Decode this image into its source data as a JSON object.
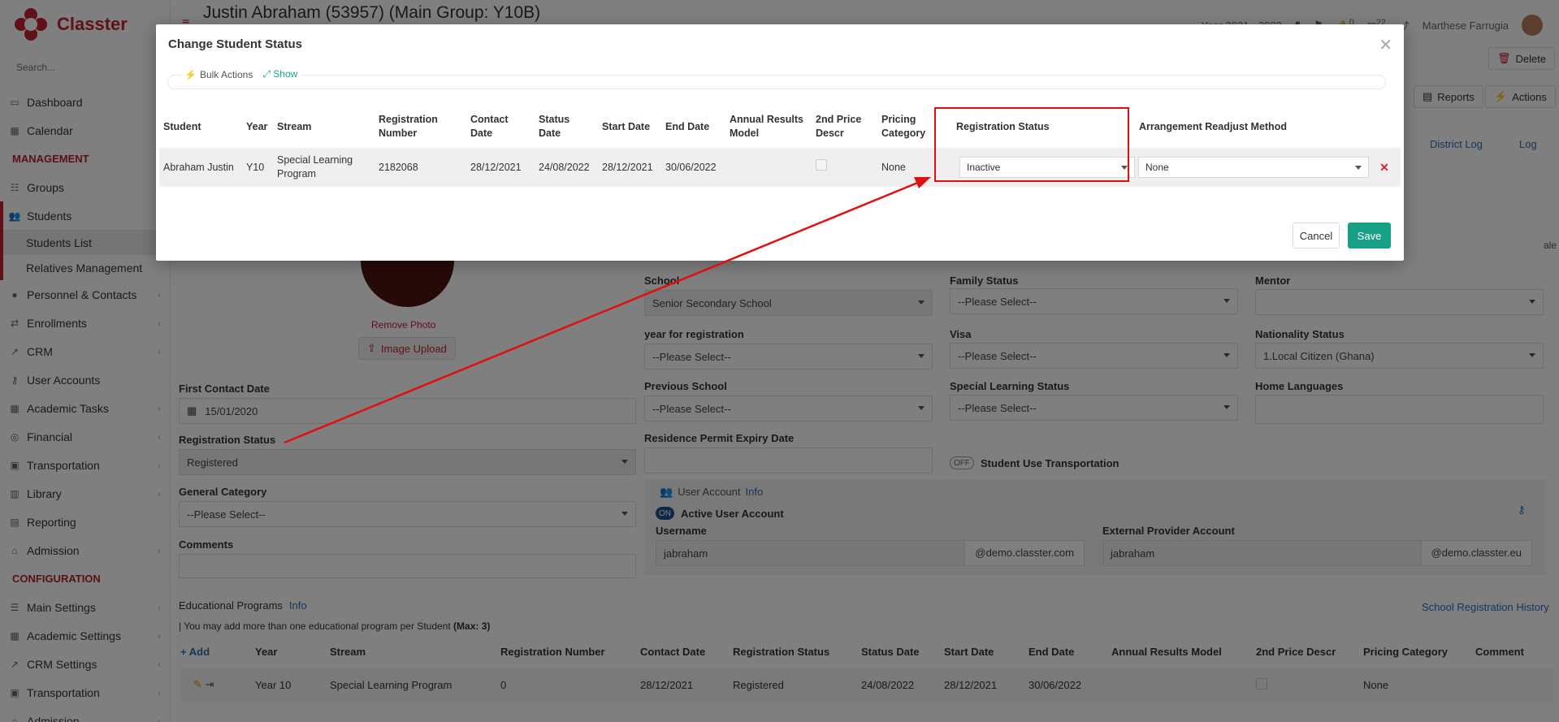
{
  "app": {
    "brand": "Classter",
    "search_placeholder": "Search...",
    "page_title": "Justin Abraham (53957) (Main Group: Y10B)",
    "year_selector": "Year 2021 - 2022",
    "user_name": "Marthese Farrugia",
    "notif_count_1": "0",
    "notif_count_2": "22"
  },
  "sidebar": {
    "items": [
      {
        "label": "Dashboard",
        "icon": "monitor-icon"
      },
      {
        "label": "Calendar",
        "icon": "calendar-icon"
      }
    ],
    "section_management": "MANAGEMENT",
    "management": [
      {
        "label": "Groups",
        "icon": "groups-icon"
      },
      {
        "label": "Students",
        "icon": "students-icon"
      }
    ],
    "students_sub": [
      "Students List",
      "Relatives Management"
    ],
    "management2": [
      {
        "label": "Personnel & Contacts",
        "icon": "person-icon"
      },
      {
        "label": "Enrollments",
        "icon": "exchange-icon"
      },
      {
        "label": "CRM",
        "icon": "crm-icon"
      },
      {
        "label": "User Accounts",
        "icon": "key-icon"
      },
      {
        "label": "Academic Tasks",
        "icon": "grid-icon"
      },
      {
        "label": "Financial",
        "icon": "coins-icon"
      },
      {
        "label": "Transportation",
        "icon": "bus-icon"
      },
      {
        "label": "Library",
        "icon": "library-icon"
      },
      {
        "label": "Reporting",
        "icon": "report-icon"
      },
      {
        "label": "Admission",
        "icon": "bank-icon"
      }
    ],
    "section_configuration": "CONFIGURATION",
    "configuration": [
      {
        "label": "Main Settings",
        "icon": "sliders-icon"
      },
      {
        "label": "Academic Settings",
        "icon": "grid-icon"
      },
      {
        "label": "CRM Settings",
        "icon": "crm-icon"
      },
      {
        "label": "Transportation",
        "icon": "bus-icon"
      },
      {
        "label": "Admission",
        "icon": "bank-icon"
      }
    ]
  },
  "background": {
    "delete_label": "Delete",
    "reports_label": "Reports",
    "actions_label": "Actions",
    "district_log": "District Log",
    "log": "Log",
    "remove_photo": "Remove Photo",
    "image_upload": "Image Upload",
    "first_contact_label": "First Contact Date",
    "first_contact_value": "15/01/2020",
    "reg_status_label": "Registration Status",
    "reg_status_value": "Registered",
    "general_category_label": "General Category",
    "general_category_value": "--Please Select--",
    "comments_label": "Comments",
    "school_label": "School",
    "school_value": "Senior Secondary School",
    "year_reg_label": "year for registration",
    "year_reg_value": "--Please Select--",
    "prev_school_label": "Previous School",
    "prev_school_value": "--Please Select--",
    "residence_label": "Residence Permit Expiry Date",
    "family_status_label": "Family Status",
    "family_status_value": "--Please Select--",
    "visa_label": "Visa",
    "visa_value": "--Please Select--",
    "special_learning_label": "Special Learning Status",
    "special_learning_value": "--Please Select--",
    "transport_toggle": "OFF",
    "transport_label": "Student Use Transportation",
    "mentor_label": "Mentor",
    "nationality_label": "Nationality Status",
    "nationality_value": "1.Local Citizen (Ghana)",
    "home_languages_label": "Home Languages",
    "user_account_label": "User Account",
    "info_label": "Info",
    "active_toggle": "ON",
    "active_account_label": "Active User Account",
    "username_label": "Username",
    "username_value": "jabraham",
    "username_domain": "@demo.classter.com",
    "external_label": "External Provider Account",
    "external_value": "jabraham",
    "external_domain": "@demo.classter.eu",
    "edu_programs_label": "Educational Programs",
    "edu_info": "Info",
    "edu_note": "| You may add more than one educational program per Student",
    "edu_note_max": "(Max: 3)",
    "school_reg_history": "School Registration History",
    "edu_add": "Add",
    "edu_headers": [
      "Year",
      "Stream",
      "Registration Number",
      "Contact Date",
      "Registration Status",
      "Status Date",
      "Start Date",
      "End Date",
      "Annual Results Model",
      "2nd Price Descr",
      "Pricing Category",
      "Comment"
    ],
    "edu_row": [
      "Year 10",
      "Special Learning Program",
      "0",
      "28/12/2021",
      "Registered",
      "24/08/2022",
      "28/12/2021",
      "30/06/2022",
      "",
      "",
      "None",
      ""
    ],
    "scale_fragment": "ale"
  },
  "modal": {
    "title": "Change Student Status",
    "bulk_actions": "Bulk Actions",
    "show": "Show",
    "headers": [
      "Student",
      "Year",
      "Stream",
      "Registration Number",
      "Contact Date",
      "Status Date",
      "Start Date",
      "End Date",
      "Annual Results Model",
      "2nd Price Descr",
      "Pricing Category",
      "Registration Status",
      "Arrangement Readjust Method"
    ],
    "row": {
      "student": "Abraham Justin",
      "year": "Y10",
      "stream": "Special Learning Program",
      "reg_number": "2182068",
      "contact_date": "28/12/2021",
      "status_date": "24/08/2022",
      "start_date": "28/12/2021",
      "end_date": "30/06/2022",
      "annual_results": "",
      "pricing_category": "None",
      "registration_status": "Inactive",
      "arrangement_method": "None"
    },
    "cancel": "Cancel",
    "save": "Save"
  },
  "colors": {
    "brand": "#c5212f",
    "save": "#16a085",
    "highlight": "#e01010",
    "link": "#2a6fb5"
  }
}
